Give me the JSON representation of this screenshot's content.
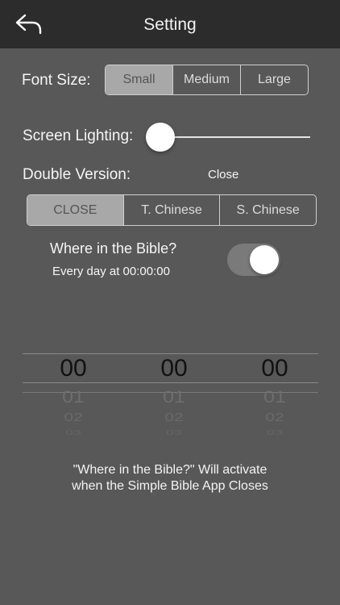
{
  "nav": {
    "title": "Setting",
    "back_icon": "back-arrow-icon"
  },
  "font_size": {
    "label": "Font Size:",
    "options": [
      "Small",
      "Medium",
      "Large"
    ],
    "selected": "Small"
  },
  "screen_lighting": {
    "label": "Screen Lighting:",
    "value": 0
  },
  "double_version": {
    "label": "Double Version:",
    "value": "Close",
    "options": [
      "CLOSE",
      "T. Chinese",
      "S. Chinese"
    ],
    "selected": "CLOSE"
  },
  "reminder": {
    "title": "Where in the Bible?",
    "subtitle": "Every day at 00:00:00",
    "enabled": true
  },
  "picker": {
    "hours": [
      "00",
      "01",
      "02",
      "03"
    ],
    "minutes": [
      "00",
      "01",
      "02",
      "03"
    ],
    "seconds": [
      "00",
      "01",
      "02",
      "03"
    ]
  },
  "note": {
    "line1": "\"Where in the Bible?\" Will activate",
    "line2": "when the Simple Bible App Closes"
  },
  "colors": {
    "navbar": "#2c2c2c",
    "background": "#585858",
    "selected_segment": "#a8a8a8"
  }
}
